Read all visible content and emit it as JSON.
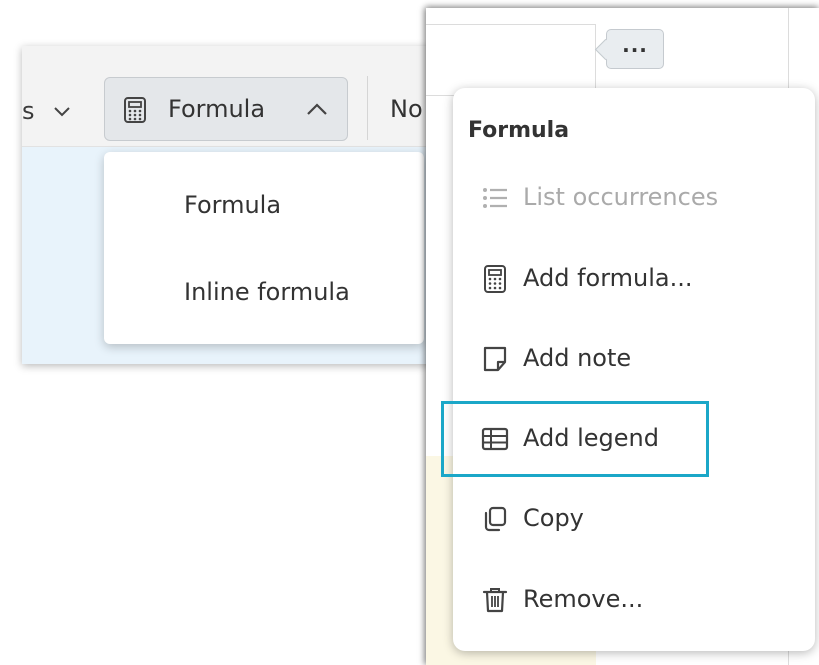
{
  "toolbar": {
    "left_fragment": "s",
    "formula_label": "Formula",
    "next_fragment": "No"
  },
  "formula_dropdown": {
    "options": [
      "Formula",
      "Inline formula"
    ]
  },
  "context_menu": {
    "more_button": "...",
    "title": "Formula",
    "items": [
      {
        "label": "List occurrences",
        "icon": "list-icon",
        "disabled": true
      },
      {
        "label": "Add formula...",
        "icon": "calculator-icon",
        "disabled": false
      },
      {
        "label": "Add note",
        "icon": "note-icon",
        "disabled": false
      },
      {
        "label": "Add legend",
        "icon": "table-icon",
        "disabled": false
      },
      {
        "label": "Copy",
        "icon": "copy-icon",
        "disabled": false
      },
      {
        "label": "Remove...",
        "icon": "trash-icon",
        "disabled": false
      }
    ]
  },
  "colors": {
    "highlight": "#1ba7c8",
    "toolbar_bg": "#f3f3f3",
    "content_bg": "#e8f3fb",
    "disabled_text": "#aaaaaa"
  }
}
